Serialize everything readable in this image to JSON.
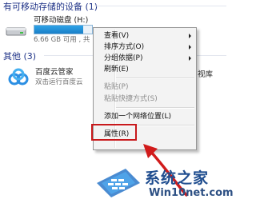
{
  "explorer": {
    "removable_group_label": "有可移动存储的设备 (1)",
    "drive": {
      "name": "可移动磁盘 (H:)",
      "size_text": "6.66 GB 可用 , 共",
      "used_fraction": 0.85,
      "bar_color": "#2ea3e7"
    },
    "other_group_label": "其他 (3)",
    "app": {
      "name": "百度云管家",
      "subtitle": "双击运行百度云"
    },
    "partial_item_label": "视库"
  },
  "context_menu": {
    "items": [
      {
        "label": "查看(V)",
        "submenu": true,
        "disabled": false
      },
      {
        "label": "排序方式(O)",
        "submenu": true,
        "disabled": false
      },
      {
        "label": "分组依据(P)",
        "submenu": true,
        "disabled": false
      },
      {
        "label": "刷新(E)",
        "submenu": false,
        "disabled": false
      },
      {
        "label": "粘贴(P)",
        "submenu": false,
        "disabled": true
      },
      {
        "label": "粘贴快捷方式(S)",
        "submenu": false,
        "disabled": true
      },
      {
        "label": "添加一个网络位置(L)",
        "submenu": false,
        "disabled": false
      },
      {
        "label": "属性(R)",
        "submenu": false,
        "disabled": false
      }
    ],
    "highlight_color": "#c8191c"
  },
  "watermark": {
    "title": "系统之家",
    "url": "Win10net.com"
  }
}
